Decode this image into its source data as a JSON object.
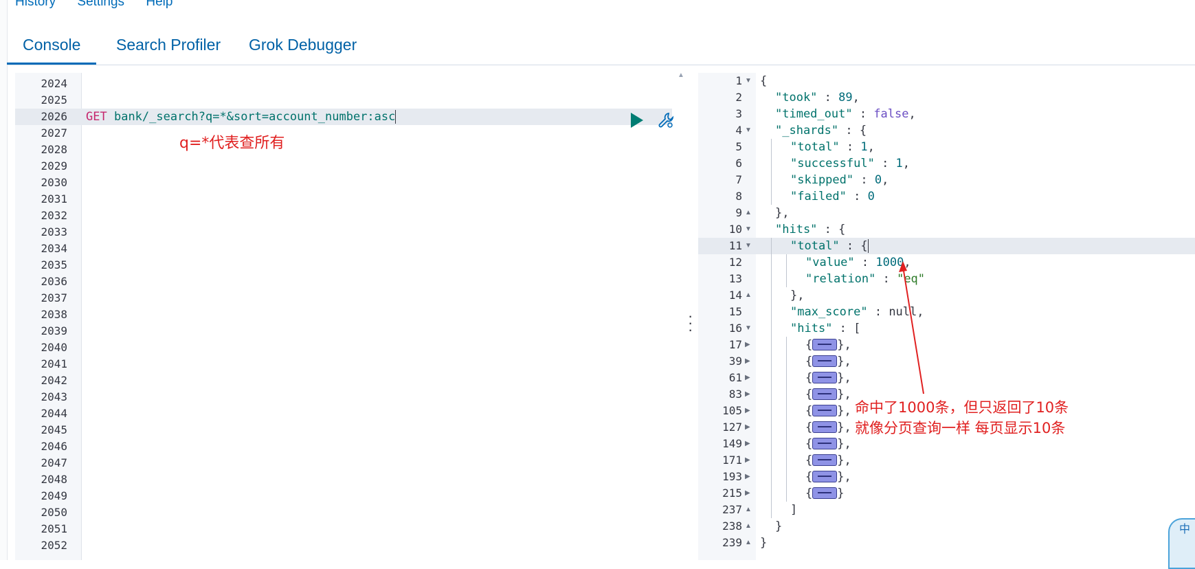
{
  "top_menu": [
    "History",
    "Settings",
    "Help"
  ],
  "tabs": [
    "Console",
    "Search Profiler",
    "Grok Debugger"
  ],
  "editor": {
    "line_numbers": [
      "2024",
      "2025",
      "2026",
      "2027",
      "2028",
      "2029",
      "2030",
      "2031",
      "2032",
      "2033",
      "2034",
      "2035",
      "2036",
      "2037",
      "2038",
      "2039",
      "2040",
      "2041",
      "2042",
      "2043",
      "2044",
      "2045",
      "2046",
      "2047",
      "2048",
      "2049",
      "2050",
      "2051",
      "2052"
    ],
    "request_method": "GET",
    "request_url": "bank/_search?q=*&sort=account_number:asc",
    "annotation": "q=*代表查所有"
  },
  "output": {
    "line_numbers": [
      "1",
      "2",
      "3",
      "4",
      "5",
      "6",
      "7",
      "8",
      "9",
      "10",
      "11",
      "12",
      "13",
      "14",
      "15",
      "16",
      "17",
      "39",
      "61",
      "83",
      "105",
      "127",
      "149",
      "171",
      "193",
      "215",
      "237",
      "238",
      "239"
    ],
    "annotation_line1": "命中了1000条，但只返回了10条",
    "annotation_line2": "就像分页查询一样 每页显示10条"
  },
  "response": {
    "took": "89",
    "timed_out": "false",
    "shards_total": "1",
    "shards_successful": "1",
    "shards_skipped": "0",
    "shards_failed": "0",
    "hits_total_value": "1000",
    "hits_total_relation": "\"eq\"",
    "max_score": "null"
  },
  "floating_widget": "中"
}
